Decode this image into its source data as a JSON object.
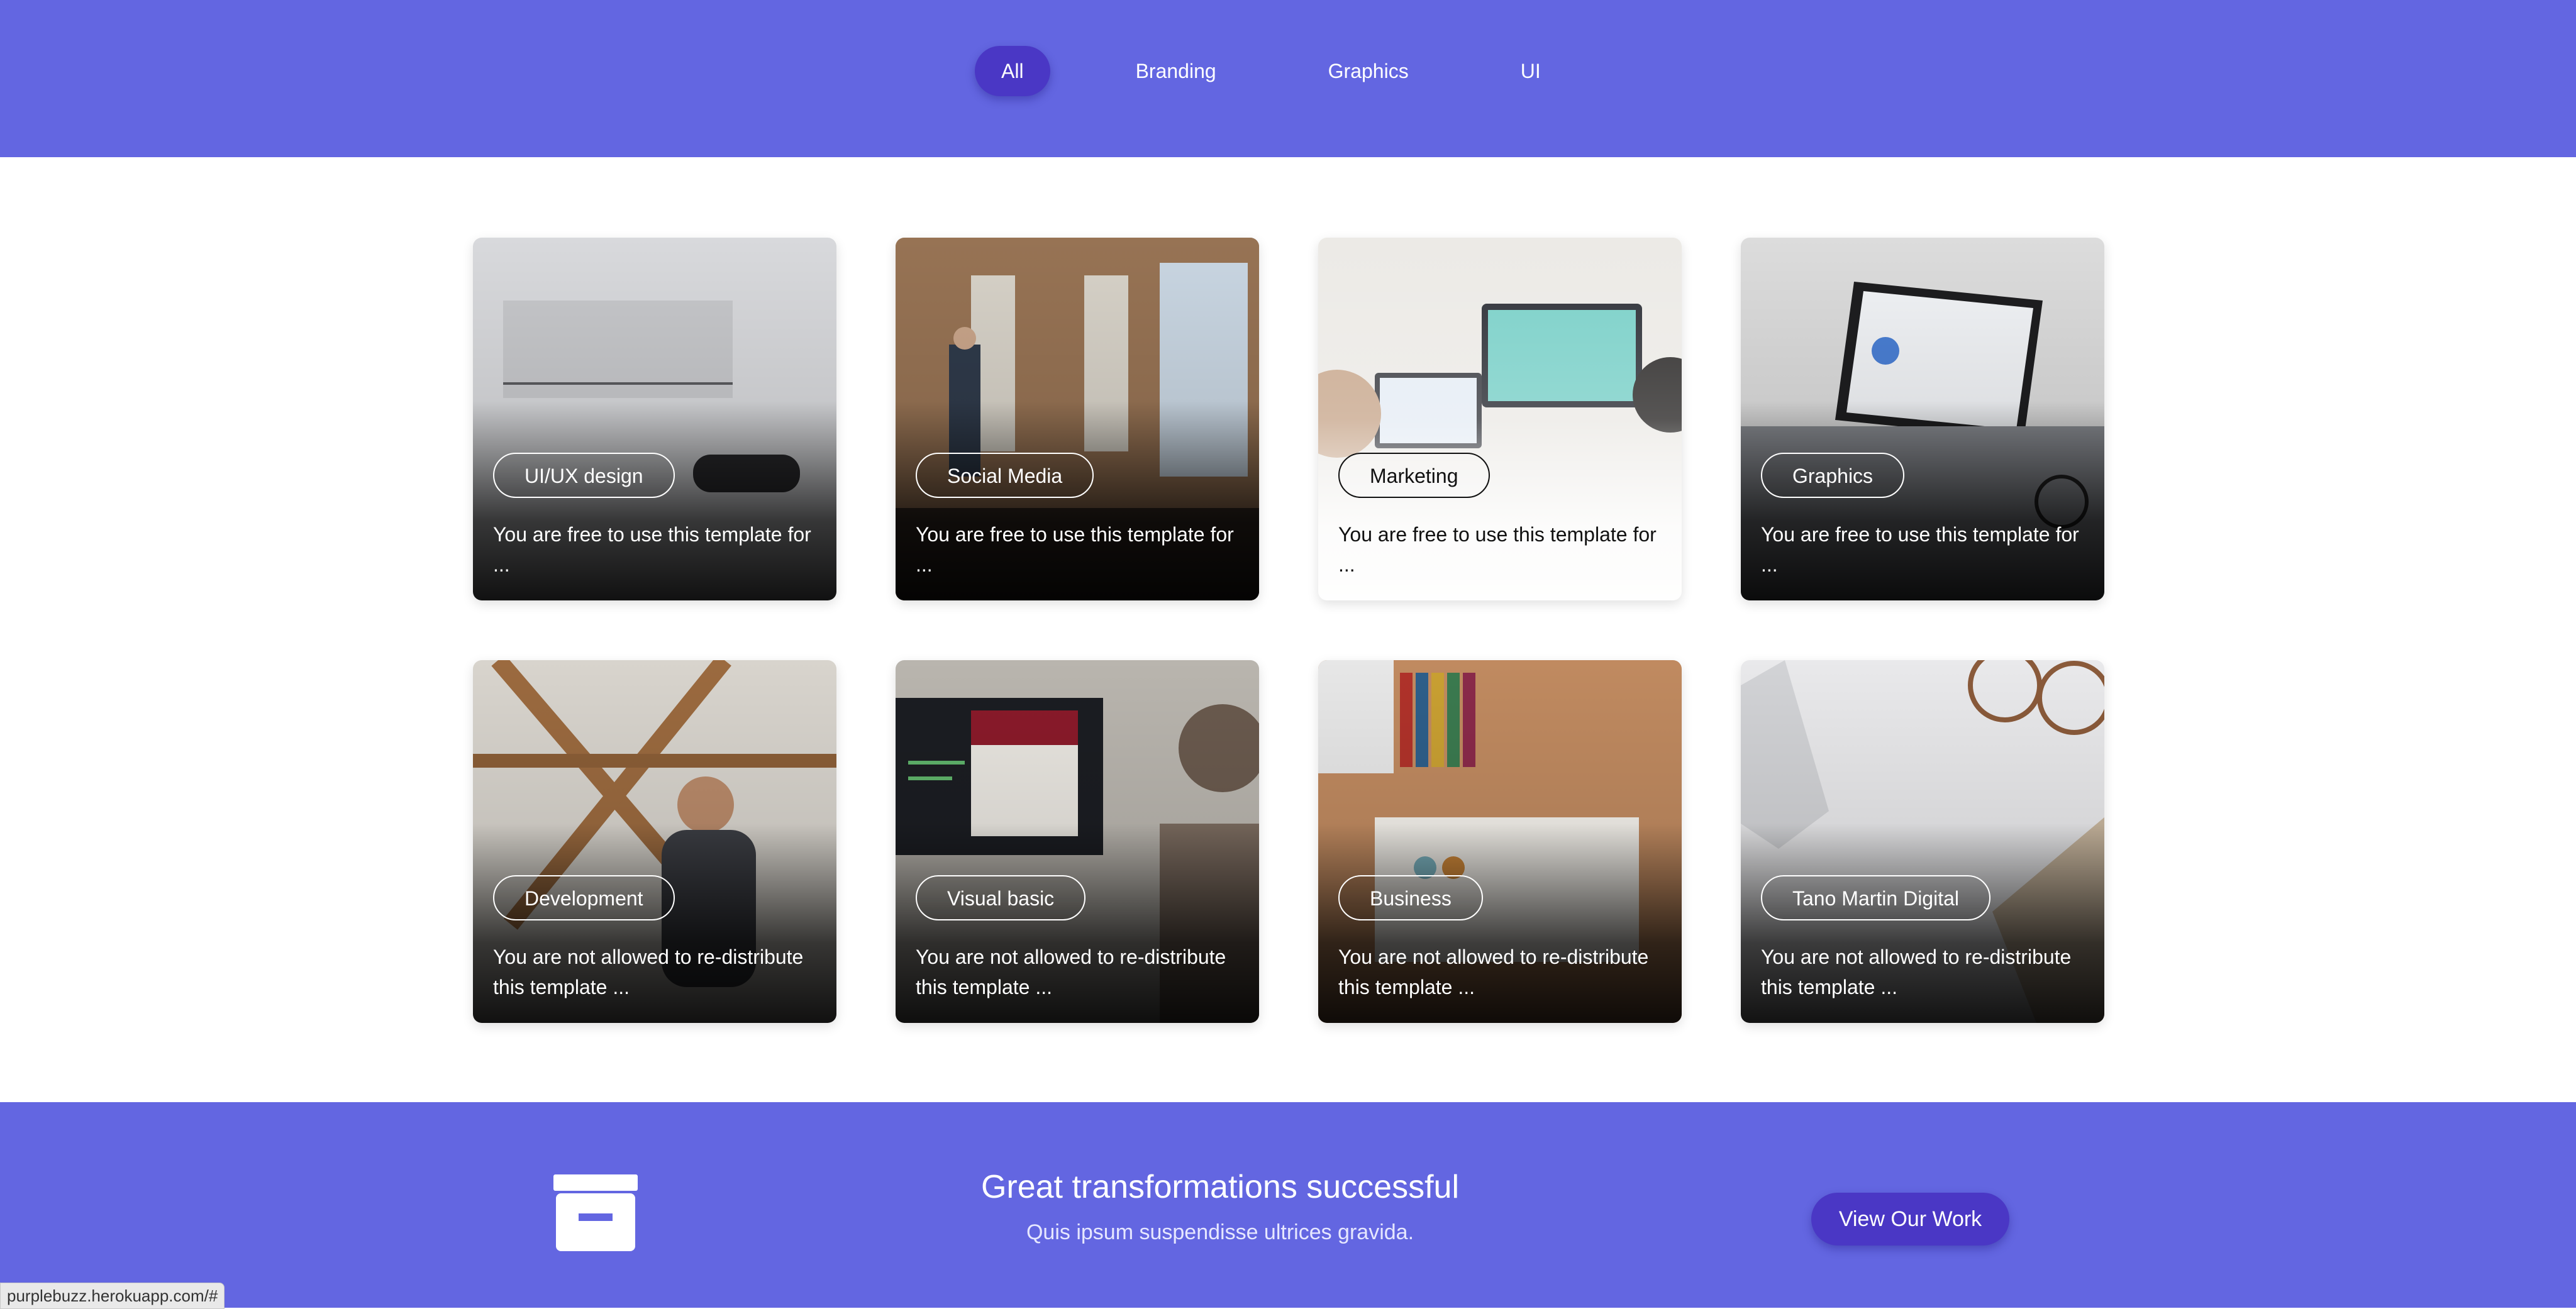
{
  "filters": {
    "items": [
      "All",
      "Branding",
      "Graphics",
      "UI"
    ],
    "active": "All"
  },
  "cards": [
    {
      "tag": "UI/UX design",
      "desc": "You are free to use this template for ..."
    },
    {
      "tag": "Social Media",
      "desc": "You are free to use this template for ..."
    },
    {
      "tag": "Marketing",
      "desc": "You are free to use this template for ..."
    },
    {
      "tag": "Graphics",
      "desc": "You are free to use this template for ..."
    },
    {
      "tag": "Development",
      "desc": "You are not allowed to re-distribute this template ..."
    },
    {
      "tag": "Visual basic",
      "desc": "You are not allowed to re-distribute this template ..."
    },
    {
      "tag": "Business",
      "desc": "You are not allowed to re-distribute this template ..."
    },
    {
      "tag": "Tano Martin Digital",
      "desc": "You are not allowed to re-distribute this template ..."
    }
  ],
  "promo": {
    "icon": "archive-box-icon",
    "title": "Great transformations successful",
    "subtitle": "Quis ipsum suspendisse ultrices gravida.",
    "button": "View Our Work"
  },
  "status_bar": {
    "url": "purplebuzz.herokuapp.com/#"
  },
  "colors": {
    "brand": "#6366e1",
    "accent": "#4a37c5"
  }
}
